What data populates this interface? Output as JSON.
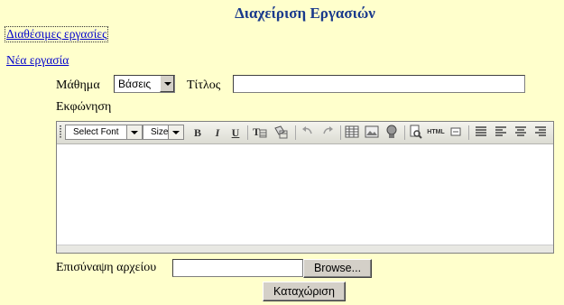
{
  "page": {
    "title": "Διαχείριση Εργασιών"
  },
  "links": {
    "available": "Διαθέσιμες εργασίες",
    "new": "Νέα εργασία"
  },
  "form": {
    "course_label": "Μάθημα",
    "course_value": "Βάσεις",
    "title_label": "Τίτλος",
    "title_value": "",
    "description_label": "Εκφώνηση",
    "attach_label": "Επισύναψη αρχείου",
    "file_value": "",
    "browse_button": "Browse...",
    "submit_button": "Καταχώριση"
  },
  "editor": {
    "font_select": "Select Font",
    "size_select": "Size",
    "bold": "B",
    "italic": "I",
    "underline": "U",
    "html": "HTML",
    "content": ""
  }
}
